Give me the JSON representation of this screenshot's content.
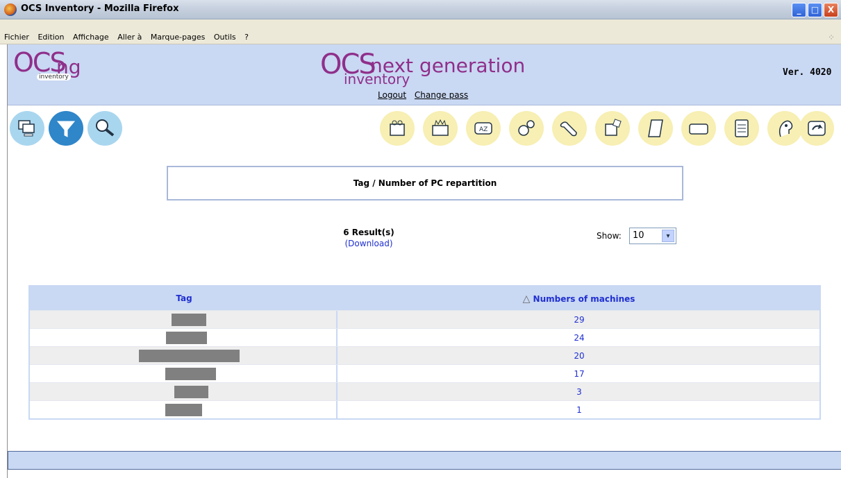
{
  "window": {
    "title": "OCS Inventory - Mozilla Firefox",
    "minimize": "_",
    "maximize": "□",
    "close": "X"
  },
  "menu": [
    "Fichier",
    "Edition",
    "Affichage",
    "Aller à",
    "Marque-pages",
    "Outils",
    "?"
  ],
  "header": {
    "logo_left_ocs": "OCS",
    "logo_left_ng": "ng",
    "logo_left_inventory": "inventory",
    "logo_center_ocs": "OCS",
    "logo_center_next": "next generation",
    "logo_center_inventory": "inventory",
    "logout": "Logout",
    "change_pass": "Change pass",
    "version": "Ver. 4020"
  },
  "icons_left": [
    "computers-icon",
    "filter-icon",
    "search-icon"
  ],
  "icons_right": [
    "packages-icon",
    "firewall-icon",
    "dictionary-icon",
    "config-icon",
    "wrench-icon",
    "registry-icon",
    "notes-icon",
    "card-icon",
    "document-icon",
    "help-icon",
    "back-icon"
  ],
  "page": {
    "title": "Tag / Number of PC repartition",
    "results": "6 Result(s)",
    "download": "(Download)",
    "show_label": "Show:",
    "show_value": "10",
    "show_arrow": "▾"
  },
  "table": {
    "col_tag": "Tag",
    "col_count": "Numbers of machines",
    "sort_icon": "△",
    "rows": [
      {
        "count": "29"
      },
      {
        "count": "24"
      },
      {
        "count": "20"
      },
      {
        "count": "17"
      },
      {
        "count": "3"
      },
      {
        "count": "1"
      }
    ]
  }
}
